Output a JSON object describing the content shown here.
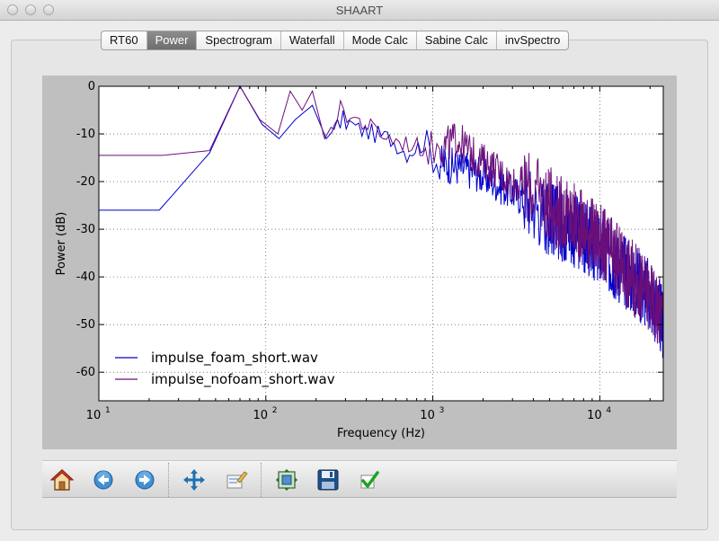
{
  "window": {
    "title": "SHAART"
  },
  "tabs": [
    {
      "label": "RT60",
      "active": false
    },
    {
      "label": "Power",
      "active": true
    },
    {
      "label": "Spectrogram",
      "active": false
    },
    {
      "label": "Waterfall",
      "active": false
    },
    {
      "label": "Mode Calc",
      "active": false
    },
    {
      "label": "Sabine Calc",
      "active": false
    },
    {
      "label": "invSpectro",
      "active": false
    }
  ],
  "chart_data": {
    "type": "line",
    "xlabel": "Frequency (Hz)",
    "ylabel": "Power (dB)",
    "xscale": "log",
    "xlim": [
      10,
      24000
    ],
    "ylim": [
      -66,
      0
    ],
    "xticks": [
      {
        "label": "10",
        "sup": "1",
        "value": 10
      },
      {
        "label": "10",
        "sup": "2",
        "value": 100
      },
      {
        "label": "10",
        "sup": "3",
        "value": 1000
      },
      {
        "label": "10",
        "sup": "4",
        "value": 10000
      }
    ],
    "yticks": [
      0,
      -10,
      -20,
      -30,
      -40,
      -50,
      -60
    ],
    "grid": true,
    "legend_position": "lower-left",
    "series": [
      {
        "name": "impulse_foam_short.wav",
        "color": "#0000cc",
        "x": [
          10,
          23,
          46,
          70,
          95,
          120,
          150,
          190,
          230,
          290,
          360,
          450,
          560,
          700,
          880,
          1100,
          1400,
          1800,
          2300,
          2900,
          3700,
          4700,
          6000,
          7600,
          9700,
          12300,
          15600,
          19800,
          24000
        ],
        "y": [
          -26,
          -26,
          -14,
          0,
          -8,
          -11,
          -7,
          -4,
          -11,
          -7,
          -9,
          -10,
          -11,
          -14,
          -12,
          -16,
          -17,
          -18,
          -20,
          -22,
          -24,
          -27,
          -29,
          -31,
          -34,
          -37,
          -40,
          -44,
          -50
        ]
      },
      {
        "name": "impulse_nofoam_short.wav",
        "color": "#6a0f7a",
        "x": [
          10,
          24,
          46,
          70,
          92,
          118,
          140,
          165,
          190,
          225,
          280,
          350,
          440,
          550,
          690,
          870,
          1100,
          1400,
          1800,
          2300,
          2900,
          3700,
          4700,
          6000,
          7600,
          9700,
          12300,
          15600,
          19800,
          24000
        ],
        "y": [
          -14.5,
          -14.5,
          -13.5,
          0,
          -7,
          -10,
          -1,
          -5,
          -1,
          -11,
          -5,
          -7,
          -9,
          -11,
          -12,
          -13,
          -13,
          -11,
          -15,
          -17,
          -20,
          -21,
          -24,
          -27,
          -29,
          -32,
          -36,
          -40,
          -44,
          -48
        ]
      }
    ]
  },
  "toolbar": {
    "buttons": [
      {
        "name": "home",
        "icon": "home-icon"
      },
      {
        "name": "back",
        "icon": "arrow-left-icon"
      },
      {
        "name": "forward",
        "icon": "arrow-right-icon"
      },
      {
        "name": "pan",
        "icon": "move-icon"
      },
      {
        "name": "zoom",
        "icon": "zoom-rect-icon"
      },
      {
        "name": "configure",
        "icon": "subplots-icon"
      },
      {
        "name": "save",
        "icon": "floppy-icon"
      },
      {
        "name": "apply",
        "icon": "checkmark-icon"
      }
    ]
  }
}
